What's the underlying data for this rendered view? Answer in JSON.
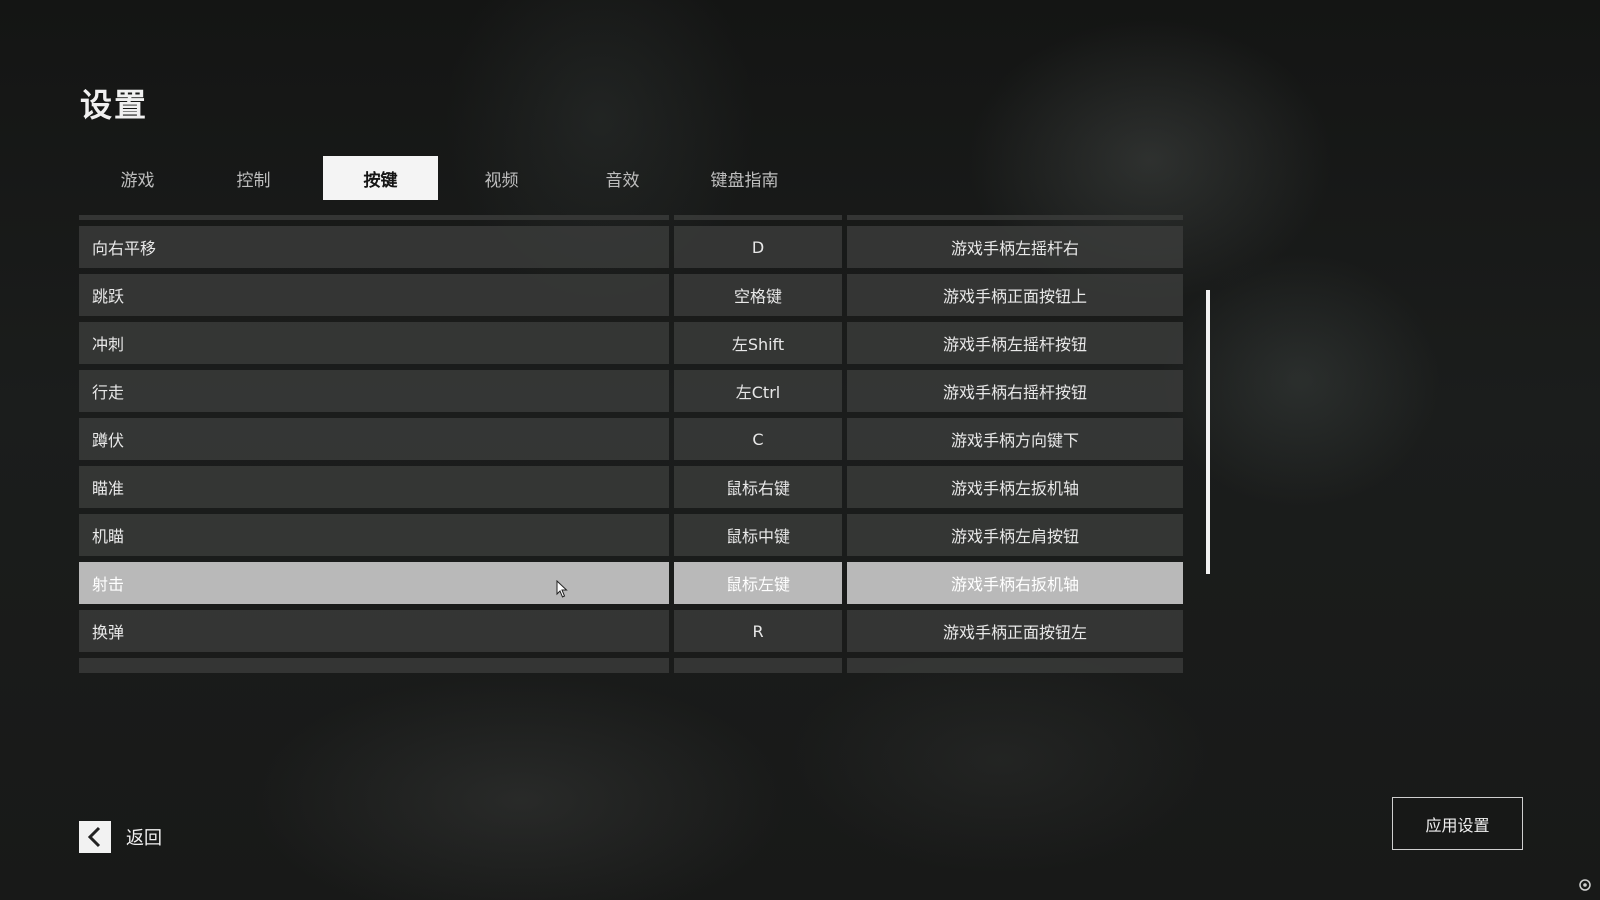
{
  "title": "设置",
  "tabs": [
    {
      "label": "游戏",
      "active": false
    },
    {
      "label": "控制",
      "active": false
    },
    {
      "label": "按键",
      "active": true
    },
    {
      "label": "视频",
      "active": false
    },
    {
      "label": "音效",
      "active": false
    },
    {
      "label": "键盘指南",
      "active": false
    }
  ],
  "bindings": [
    {
      "action": "向右平移",
      "key": "D",
      "gamepad": "游戏手柄左摇杆右"
    },
    {
      "action": "跳跃",
      "key": "空格键",
      "gamepad": "游戏手柄正面按钮上"
    },
    {
      "action": "冲刺",
      "key": "左Shift",
      "gamepad": "游戏手柄左摇杆按钮"
    },
    {
      "action": "行走",
      "key": "左Ctrl",
      "gamepad": "游戏手柄右摇杆按钮"
    },
    {
      "action": "蹲伏",
      "key": "C",
      "gamepad": "游戏手柄方向键下"
    },
    {
      "action": "瞄准",
      "key": "鼠标右键",
      "gamepad": "游戏手柄左扳机轴"
    },
    {
      "action": "机瞄",
      "key": "鼠标中键",
      "gamepad": "游戏手柄左肩按钮"
    },
    {
      "action": "射击",
      "key": "鼠标左键",
      "gamepad": "游戏手柄右扳机轴",
      "highlighted": true
    },
    {
      "action": "换弹",
      "key": "R",
      "gamepad": "游戏手柄正面按钮左"
    }
  ],
  "back_label": "返回",
  "apply_label": "应用设置",
  "colors": {
    "tab_active_bg": "#f4f4f4",
    "row_bg": "#3a3c3b",
    "row_highlight_bg": "#b9b9b9",
    "scrollbar": "#f2f2f2"
  }
}
